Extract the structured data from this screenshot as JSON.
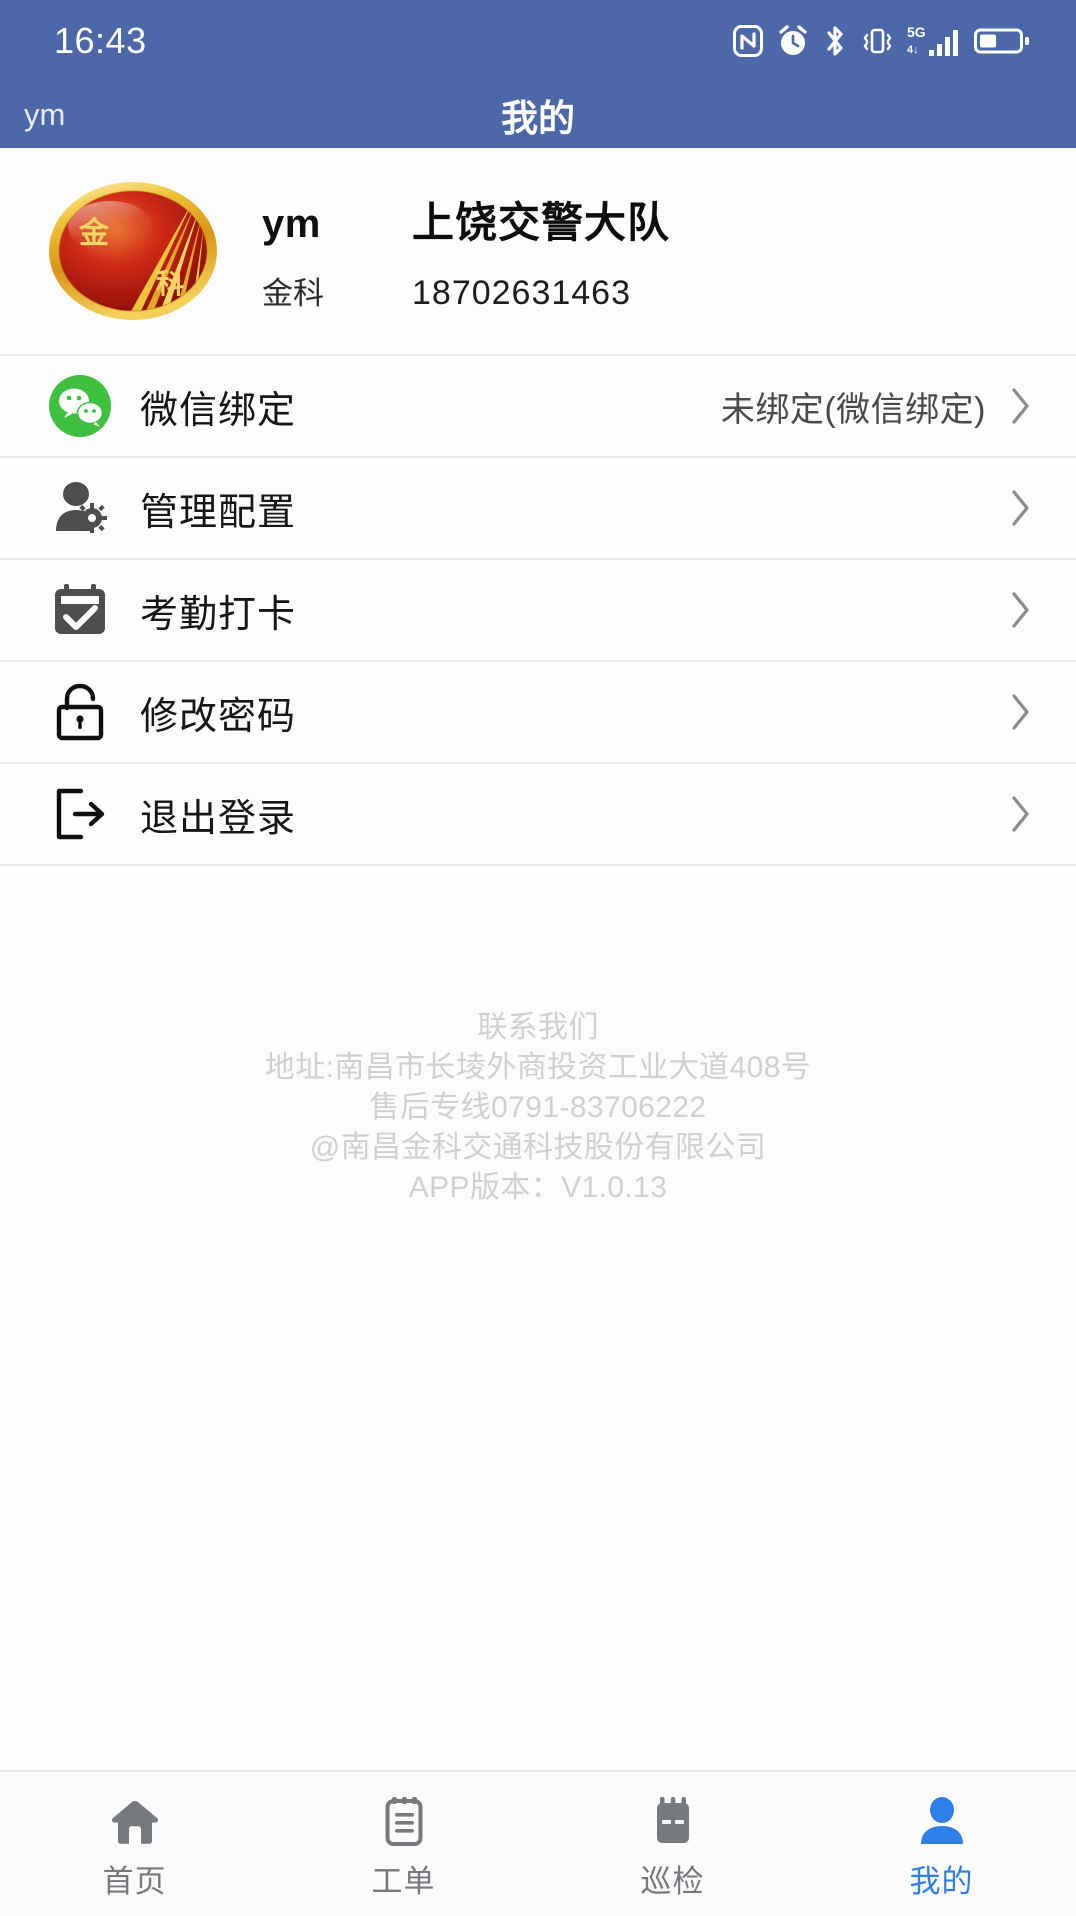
{
  "statusbar": {
    "time": "16:43",
    "icons": [
      "nfc-icon",
      "alarm-icon",
      "bluetooth-icon",
      "vibrate-icon",
      "signal-5g-icon",
      "battery-icon"
    ]
  },
  "header": {
    "left_label": "ym",
    "title": "我的",
    "background_color": "#4d68a8"
  },
  "profile": {
    "logo_alt": "金科",
    "username": "ym",
    "org": "上饶交警大队",
    "company_short": "金科",
    "phone": "18702631463"
  },
  "menu": {
    "items": [
      {
        "icon": "wechat-icon",
        "label": "微信绑定",
        "value": "未绑定(微信绑定)"
      },
      {
        "icon": "user-settings-icon",
        "label": "管理配置",
        "value": ""
      },
      {
        "icon": "calendar-check-icon",
        "label": "考勤打卡",
        "value": ""
      },
      {
        "icon": "lock-icon",
        "label": "修改密码",
        "value": ""
      },
      {
        "icon": "logout-icon",
        "label": "退出登录",
        "value": ""
      }
    ]
  },
  "contact": {
    "title": "联系我们",
    "address": "地址:南昌市长堎外商投资工业大道408号",
    "hotline": "售后专线0791-83706222",
    "company": "@南昌金科交通科技股份有限公司",
    "version": "APP版本：V1.0.13"
  },
  "tabbar": {
    "active_color": "#2f7fe8",
    "inactive_color": "#76797e",
    "tabs": [
      {
        "icon": "home-icon",
        "label": "首页",
        "active": false
      },
      {
        "icon": "order-icon",
        "label": "工单",
        "active": false
      },
      {
        "icon": "inspection-icon",
        "label": "巡检",
        "active": false
      },
      {
        "icon": "person-icon",
        "label": "我的",
        "active": true
      }
    ]
  },
  "colors": {
    "header_blue": "#4d68a8",
    "wechat_green": "#3fc03f",
    "accent_blue": "#2f7fe8",
    "icon_gray": "#4e4e4e"
  }
}
